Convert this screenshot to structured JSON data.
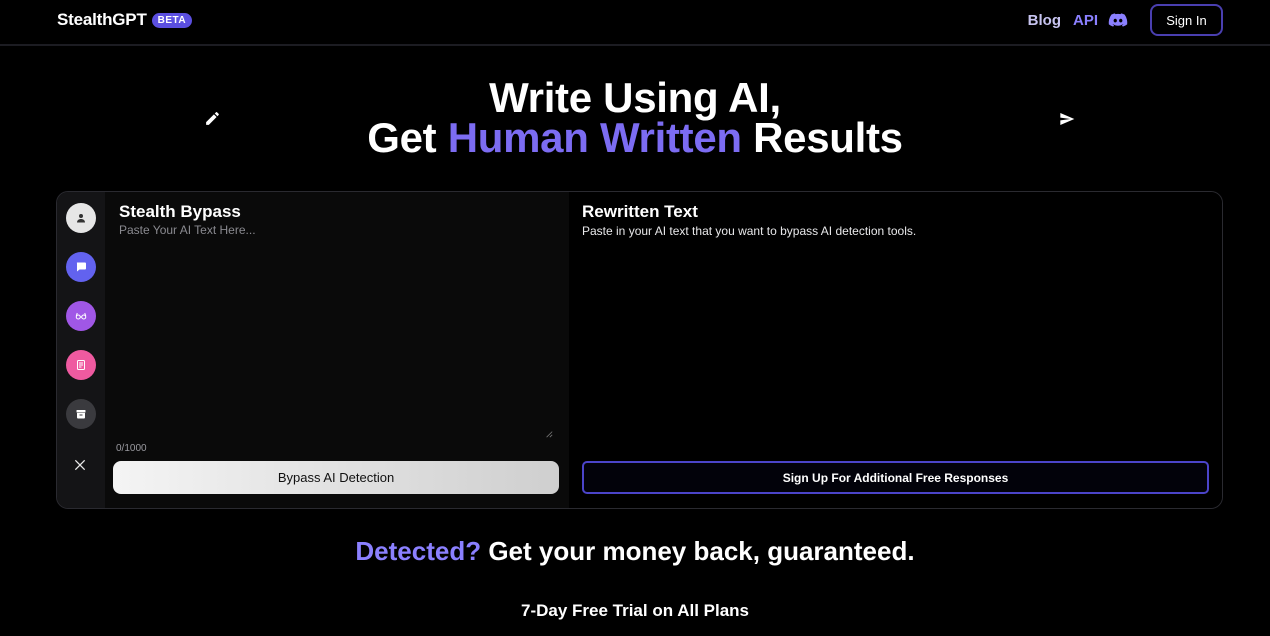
{
  "header": {
    "brand": "StealthGPT",
    "badge": "BETA",
    "nav": {
      "blog": "Blog",
      "api": "API"
    },
    "signin_label": "Sign In"
  },
  "hero": {
    "line1": "Write Using AI,",
    "line2_prefix": "Get ",
    "line2_accent": "Human Written",
    "line2_suffix": " Results"
  },
  "editor": {
    "left": {
      "title": "Stealth Bypass",
      "placeholder": "Paste Your AI Text Here...",
      "counter": "0/1000",
      "button_label": "Bypass AI Detection"
    },
    "right": {
      "title": "Rewritten Text",
      "hint": "Paste in your AI text that you want to bypass AI detection tools.",
      "button_label": "Sign Up For Additional Free Responses"
    },
    "sidebar_tools": [
      {
        "name": "profile-icon",
        "color": "#e6e6e6"
      },
      {
        "name": "chat-icon",
        "color": "#6262ef"
      },
      {
        "name": "glasses-icon",
        "color": "#a057e6"
      },
      {
        "name": "document-icon",
        "color": "#ef5aa0"
      },
      {
        "name": "archive-icon",
        "color": "#3a3a3e"
      }
    ]
  },
  "guarantee": {
    "accent": "Detected?",
    "rest": " Get your money back, guaranteed."
  },
  "trial": "7-Day Free Trial on All Plans",
  "colors": {
    "accent": "#7c6cf2",
    "border_accent": "#4b44c9",
    "background": "#000000"
  }
}
